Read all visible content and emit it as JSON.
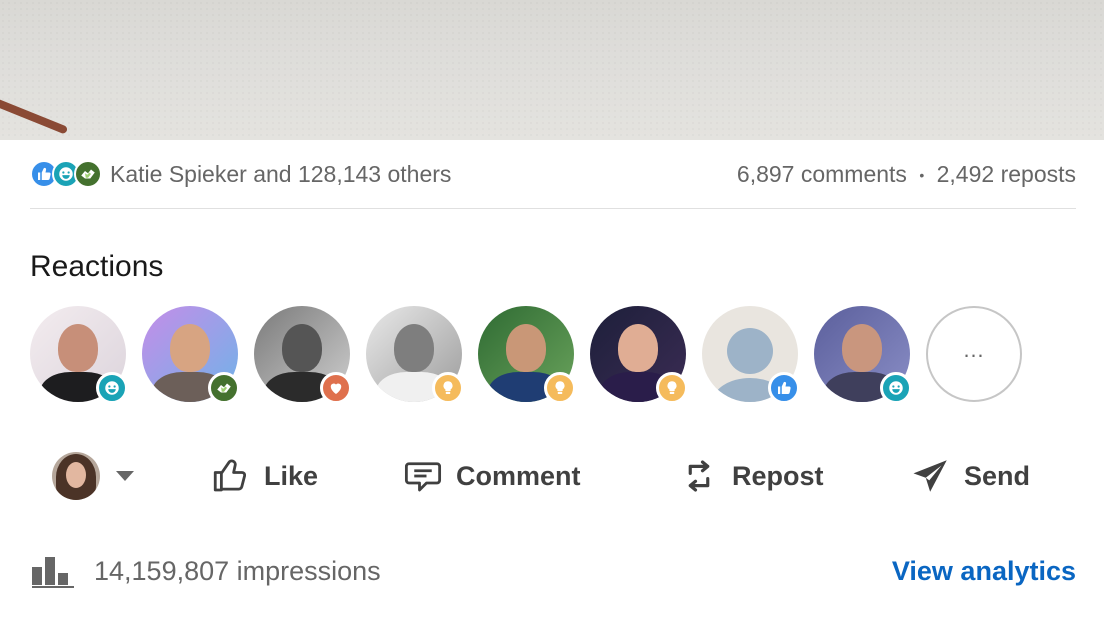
{
  "colors": {
    "link": "#0a66c2",
    "like": "#378fe9",
    "funny": "#1aa3b6",
    "support": "#44712e",
    "love": "#df704d",
    "insightful": "#f5bb5c",
    "muted_text": "#666666"
  },
  "social": {
    "reaction_icons": [
      "like-icon",
      "funny-icon",
      "support-icon"
    ],
    "reactors_text": "Katie Spieker and 128,143 others",
    "comments": "6,897 comments",
    "separator": "•",
    "reposts": "2,492 reposts"
  },
  "reactions": {
    "title": "Reactions",
    "avatars": [
      {
        "badge": "funny-icon"
      },
      {
        "badge": "support-icon"
      },
      {
        "badge": "love-icon"
      },
      {
        "badge": "insightful-icon"
      },
      {
        "badge": "insightful-icon"
      },
      {
        "badge": "insightful-icon"
      },
      {
        "badge": "like-icon"
      },
      {
        "badge": "funny-icon"
      }
    ],
    "more_label": "…"
  },
  "actions": {
    "like": "Like",
    "comment": "Comment",
    "repost": "Repost",
    "send": "Send"
  },
  "footer": {
    "impressions": "14,159,807 impressions",
    "analytics_link": "View analytics"
  }
}
